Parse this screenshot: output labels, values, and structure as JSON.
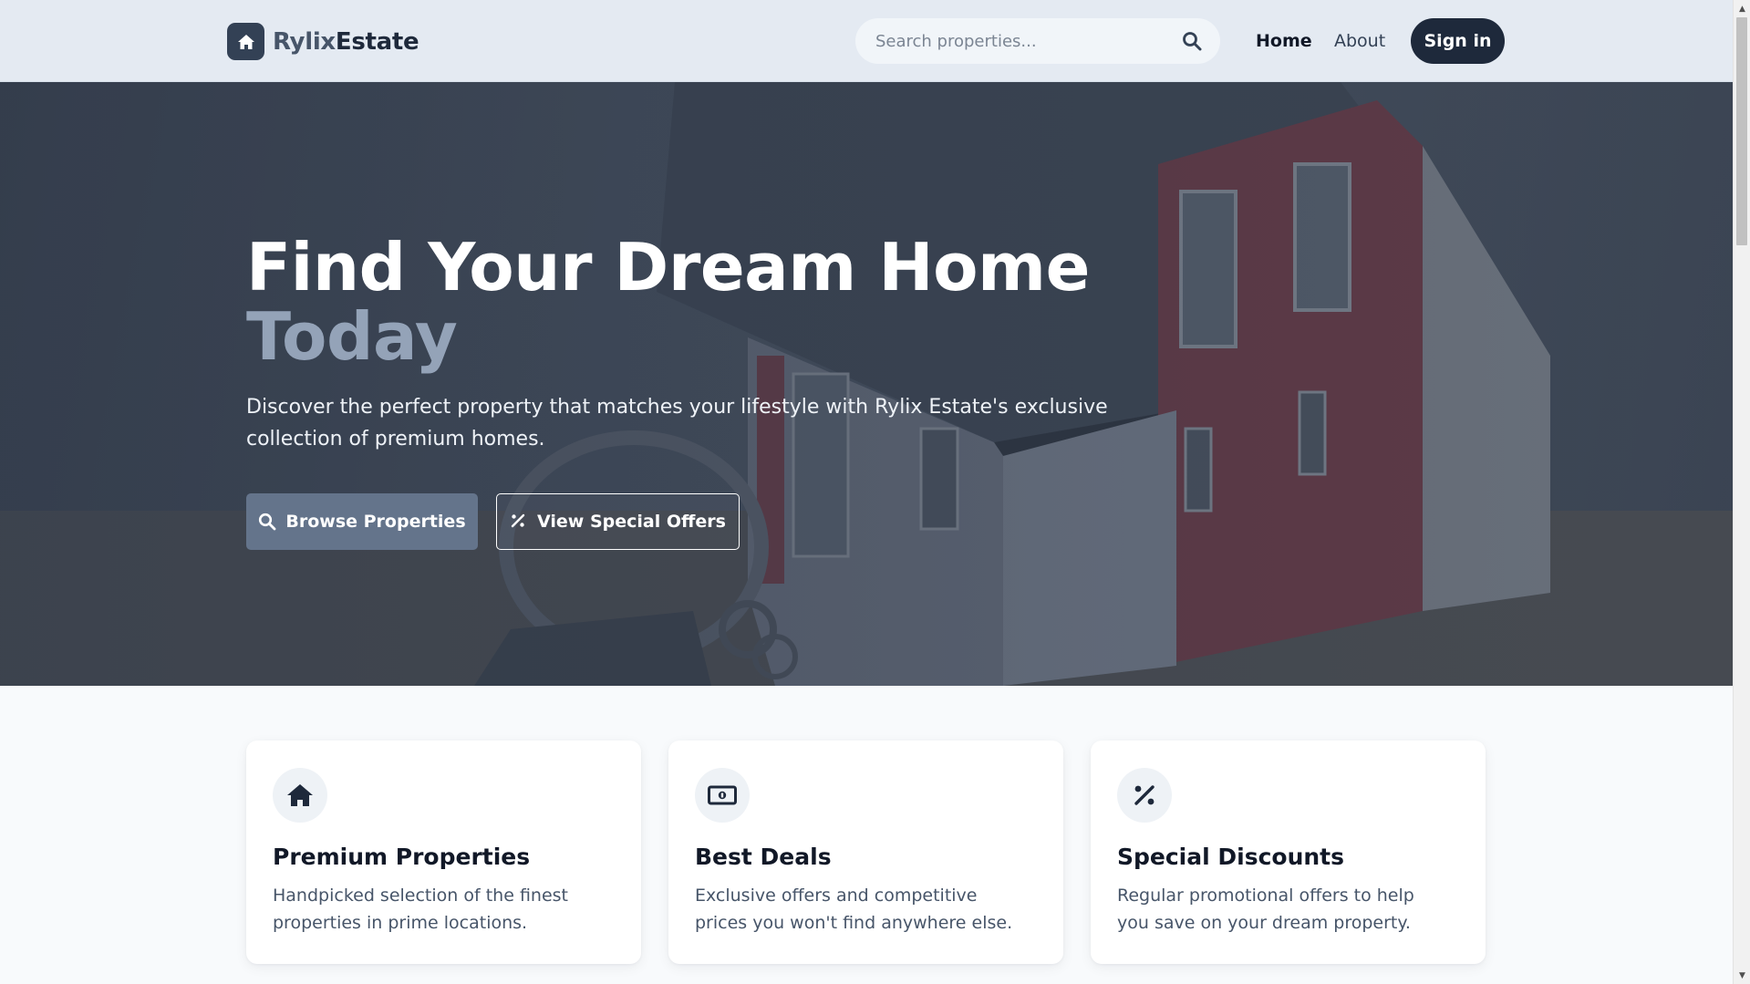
{
  "brand": {
    "name_part1": "Rylix",
    "name_part2": "Estate",
    "logo_icon": "home-icon"
  },
  "header": {
    "search": {
      "placeholder": "Search properties...",
      "value": "",
      "icon": "search-icon"
    },
    "nav": {
      "home": "Home",
      "about": "About"
    },
    "signin_label": "Sign in"
  },
  "hero": {
    "title_line1": "Find Your Dream Home",
    "title_line2": "Today",
    "subtitle": "Discover the perfect property that matches your lifestyle with Rylix Estate's exclusive collection of premium homes.",
    "primary_button": {
      "label": "Browse Properties",
      "icon": "search-icon"
    },
    "secondary_button": {
      "label": "View Special Offers",
      "icon": "percent-icon"
    }
  },
  "features": [
    {
      "icon": "home-icon",
      "title": "Premium Properties",
      "text": "Handpicked selection of the finest properties in prime locations."
    },
    {
      "icon": "money-bill-icon",
      "title": "Best Deals",
      "text": "Exclusive offers and competitive prices you won't find anywhere else."
    },
    {
      "icon": "percent-icon",
      "title": "Special Discounts",
      "text": "Regular promotional offers to help you save on your dream property."
    }
  ],
  "colors": {
    "header_bg": "#e4eaf2",
    "brand_dark": "#1e293b",
    "accent_slate": "#64748b",
    "title_accent": "#94a3b8",
    "page_bg": "#f8fafc"
  }
}
